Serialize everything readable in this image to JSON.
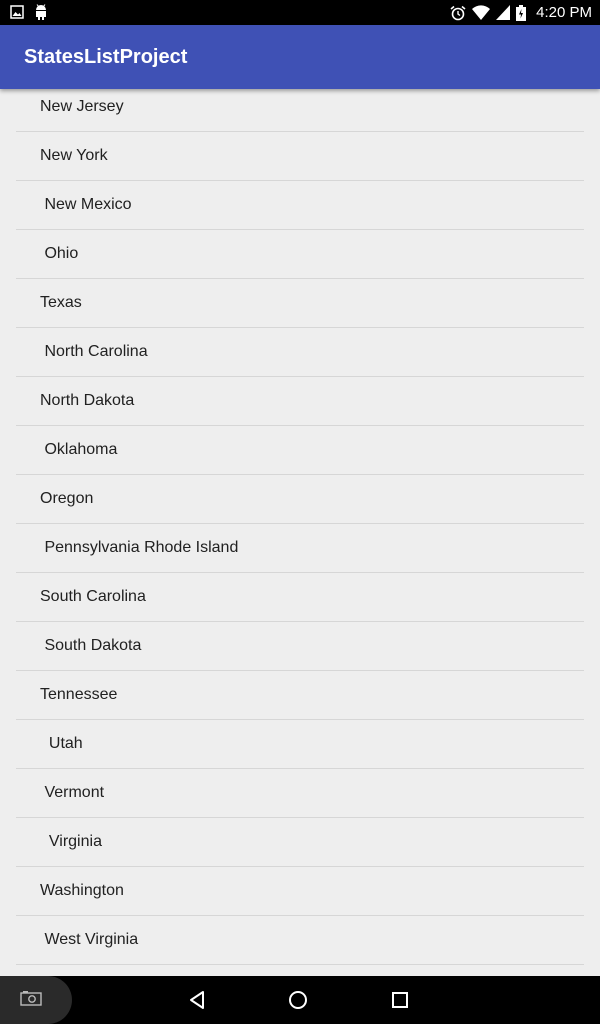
{
  "status_bar": {
    "time": "4:20 PM",
    "icons": [
      "image-notification-icon",
      "android-debug-icon",
      "alarm-icon",
      "wifi-icon",
      "signal-icon",
      "battery-icon"
    ]
  },
  "app_bar": {
    "title": "StatesListProject",
    "color": "#3f51b5"
  },
  "states": [
    "New Jersey",
    "New York",
    " New Mexico",
    " Ohio",
    "Texas",
    " North Carolina",
    "North Dakota",
    " Oklahoma",
    "Oregon",
    " Pennsylvania Rhode Island",
    "South Carolina",
    " South Dakota",
    "Tennessee",
    "  Utah",
    " Vermont",
    "  Virginia",
    "Washington",
    " West Virginia"
  ],
  "nav_bar": {
    "buttons": [
      "screenshot-icon",
      "back-icon",
      "home-icon",
      "recents-icon"
    ]
  }
}
